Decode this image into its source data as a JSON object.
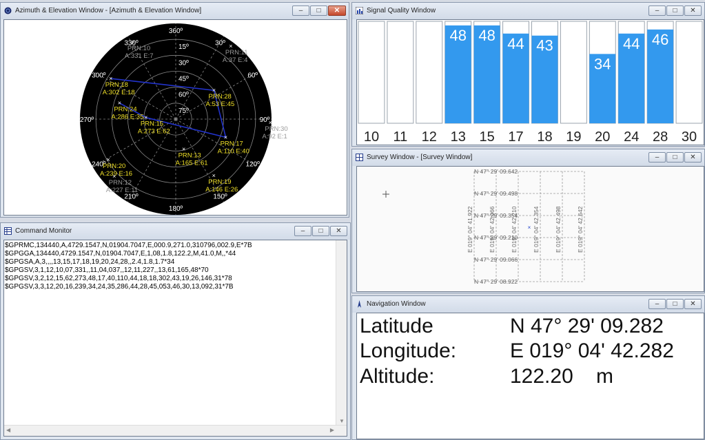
{
  "windows": {
    "azimuth": {
      "title": "Azimuth & Elevation Window - [Azimuth & Elevation Window]"
    },
    "signal": {
      "title": "Signal Quality Window"
    },
    "command": {
      "title": "Command Monitor"
    },
    "survey": {
      "title": "Survey Window - [Survey Window]"
    },
    "navigation": {
      "title": "Navigation Window"
    }
  },
  "title_buttons": {
    "minimize": "–",
    "restore": "□",
    "close": "✕"
  },
  "polar": {
    "azimuth_labels": [
      "360º",
      "30º",
      "60º",
      "90º",
      "120º",
      "150º",
      "180º",
      "210º",
      "240º",
      "270º",
      "300º",
      "330º"
    ],
    "elevation_labels": [
      "15º",
      "30º",
      "45º",
      "60º",
      "75º"
    ],
    "satellites": [
      {
        "prn": "PRN:10",
        "info": "A:331 E:7",
        "active": false
      },
      {
        "prn": "PRN:11",
        "info": "A:37 E:4",
        "active": false
      },
      {
        "prn": "PRN:18",
        "info": "A:302 E:18",
        "active": true
      },
      {
        "prn": "PRN:28",
        "info": "A:53 E:45",
        "active": true
      },
      {
        "prn": "PRN:24",
        "info": "A:286 E:35",
        "active": true
      },
      {
        "prn": "PRN:15",
        "info": "A:273 E:62",
        "active": true
      },
      {
        "prn": "PRN:30",
        "info": "A:92 E:1",
        "active": false
      },
      {
        "prn": "PRN:17",
        "info": "A:110 E:40",
        "active": true
      },
      {
        "prn": "PRN:13",
        "info": "A:165 E:61",
        "active": true
      },
      {
        "prn": "PRN:20",
        "info": "A:239 E:16",
        "active": true
      },
      {
        "prn": "PRN:12",
        "info": "A:227 E:11",
        "active": false
      },
      {
        "prn": "PRN:19",
        "info": "A:146 E:26",
        "active": true
      }
    ],
    "colors": {
      "active": "#f0e028",
      "inactive": "#9a9a9a",
      "line": "#2233cc"
    }
  },
  "chart_data": {
    "type": "bar",
    "categories": [
      "10",
      "11",
      "12",
      "13",
      "15",
      "17",
      "18",
      "19",
      "20",
      "24",
      "28",
      "30"
    ],
    "values": [
      0,
      0,
      0,
      48,
      48,
      44,
      43,
      0,
      34,
      44,
      46,
      0
    ],
    "ylim": [
      0,
      50
    ],
    "bar_color": "#3399ee"
  },
  "command": {
    "lines": [
      "$GPRMC,134440,A,4729.1547,N,01904.7047,E,000.9,271.0,310796,002.9,E*7B",
      "$GPGGA,134440,4729.1547,N,01904.7047,E,1,08,1.8,122.2,M,41.0,M,,*44",
      "$GPGSA,A,3,,,,13,15,17,18,19,20,24,28,,2.4,1.8,1.7*34",
      "$GPGSV,3,1,12,10,07,331,,11,04,037,,12,11,227,,13,61,165,48*70",
      "$GPGSV,3,2,12,15,62,273,48,17,40,110,44,18,18,302,43,19,26,146,31*78",
      "$GPGSV,3,3,12,20,16,239,34,24,35,286,44,28,45,053,46,30,13,092,31*7B"
    ]
  },
  "survey": {
    "lat_labels": [
      "N 47° 29' 09.642",
      "N 47° 29' 09.498",
      "N 47° 29' 09.354",
      "N 47° 29' 09.210",
      "N 47° 29' 09.066",
      "N 47° 29' 08.922"
    ],
    "lon_labels": [
      "E 019° 04' 41.922",
      "E 019° 04' 42.066",
      "E 019° 04' 42.210",
      "E 019° 04' 42.354",
      "E 019° 04' 42.498",
      "E 019° 04' 42.642"
    ]
  },
  "navigation": {
    "latitude_label": "Latitude",
    "latitude_value": "N 47° 29' 09.282",
    "longitude_label": "Longitude:",
    "longitude_value": "E 019° 04' 42.282",
    "altitude_label": "Altitude:",
    "altitude_value": "122.20",
    "altitude_unit": "m"
  }
}
